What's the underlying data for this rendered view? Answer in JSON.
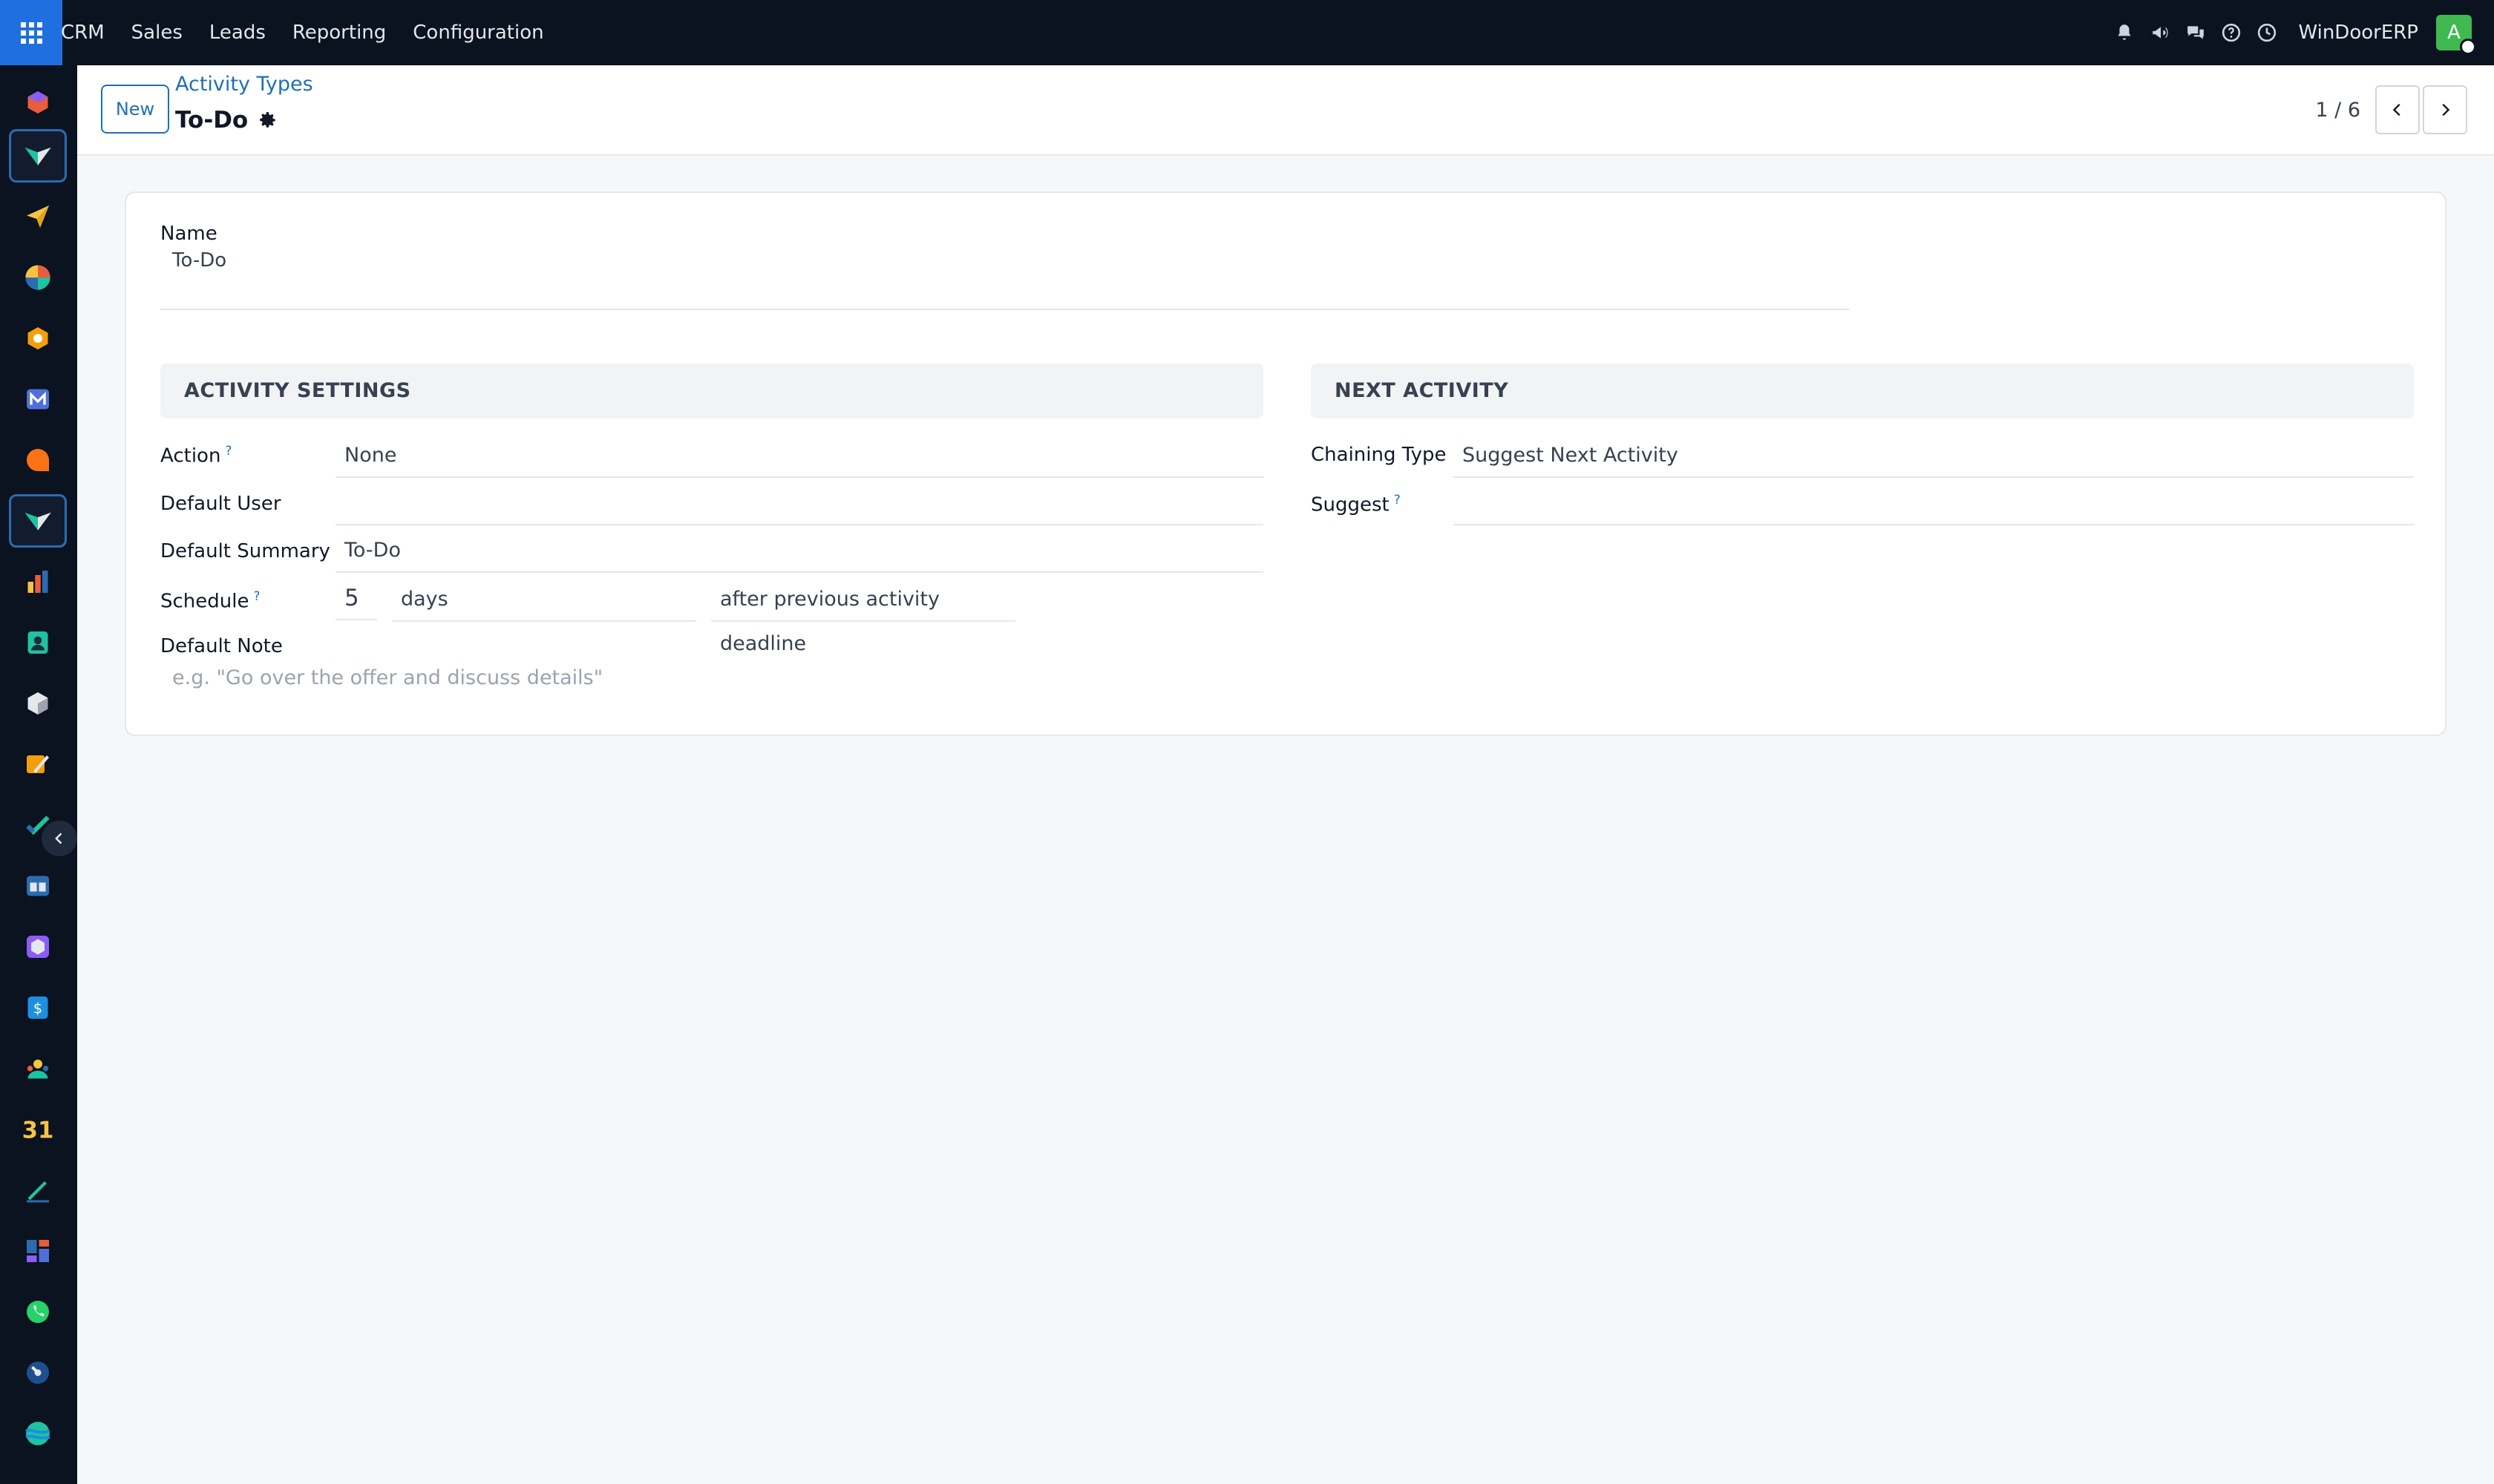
{
  "topnav": {
    "menu": [
      "CRM",
      "Sales",
      "Leads",
      "Reporting",
      "Configuration"
    ],
    "company": "WinDoorERP",
    "avatar_letter": "A",
    "icons": [
      "bell-icon",
      "megaphone-icon",
      "chat-icon",
      "help-icon",
      "clock-icon"
    ]
  },
  "sidebar": {
    "apps": [
      "discuss",
      "crm",
      "marketing",
      "dashboard",
      "inventory",
      "mail",
      "livechat",
      "crm-active",
      "reporting",
      "contacts",
      "products",
      "studio",
      "project",
      "knowledge",
      "packages",
      "accounting",
      "employees",
      "calendar",
      "sign",
      "widgets",
      "whatsapp",
      "time",
      "web"
    ]
  },
  "control": {
    "new_label": "New",
    "breadcrumb": "Activity Types",
    "title": "To-Do",
    "pager": "1 / 6"
  },
  "form": {
    "name_label": "Name",
    "name_value": "To-Do",
    "activity_settings_title": "ACTIVITY SETTINGS",
    "next_activity_title": "NEXT ACTIVITY",
    "action_label": "Action",
    "action_value": "None",
    "default_user_label": "Default User",
    "default_user_value": "",
    "default_summary_label": "Default Summary",
    "default_summary_value": "To-Do",
    "schedule_label": "Schedule",
    "schedule_number": "5",
    "schedule_unit": "days",
    "schedule_from": "after previous activity deadline",
    "default_note_label": "Default Note",
    "default_note_placeholder": "e.g. \"Go over the offer and discuss details\"",
    "chaining_type_label": "Chaining Type",
    "chaining_type_value": "Suggest Next Activity",
    "suggest_label": "Suggest",
    "suggest_value": "",
    "help_mark": "?"
  }
}
